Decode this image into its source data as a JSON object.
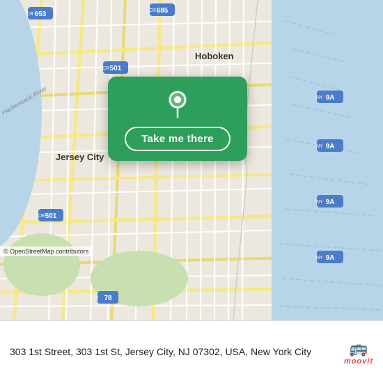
{
  "map": {
    "alt": "Map of Jersey City and Hoboken area"
  },
  "card": {
    "button_label": "Take me there"
  },
  "bottom_bar": {
    "address": "303 1st Street, 303 1st St, Jersey City, NJ 07302, USA, New York City",
    "osm_credit": "© OpenStreetMap contributors",
    "moovit_label": "moovit"
  }
}
